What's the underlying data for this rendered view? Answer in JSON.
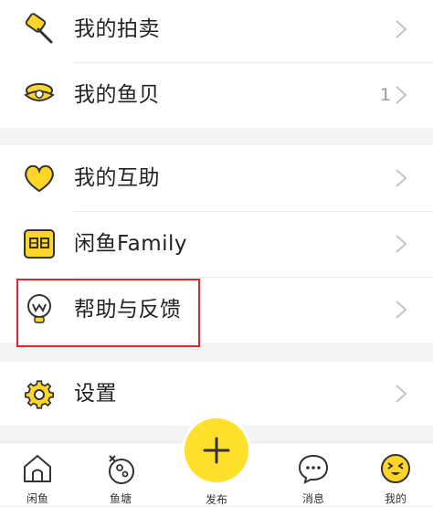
{
  "menu": {
    "auction": {
      "label": "我的拍卖"
    },
    "shells": {
      "label": "我的鱼贝",
      "count": "1"
    },
    "mutual_aid": {
      "label": "我的互助"
    },
    "family": {
      "label": "闲鱼Family"
    },
    "help_feedback": {
      "label": "帮助与反馈"
    },
    "settings": {
      "label": "设置"
    }
  },
  "tabbar": {
    "home": "闲鱼",
    "pond": "鱼塘",
    "publish": "发布",
    "messages": "消息",
    "mine": "我的"
  },
  "colors": {
    "accent_yellow": "#ffe02b",
    "highlight_red": "#e0252b",
    "background": "#f4f4f4"
  }
}
